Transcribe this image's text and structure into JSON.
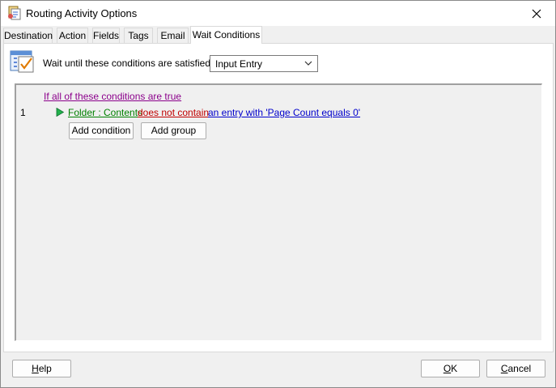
{
  "window": {
    "title": "Routing Activity Options"
  },
  "tabs": [
    {
      "label": "Destination"
    },
    {
      "label": "Action"
    },
    {
      "label": "Fields"
    },
    {
      "label": "Tags"
    },
    {
      "label": "Email"
    },
    {
      "label": "Wait Conditions",
      "active": true
    }
  ],
  "wait": {
    "label": "Wait until these conditions are satisfied for:",
    "selected": "Input Entry"
  },
  "conditions": {
    "group_link": "If all of these conditions are true",
    "rows": [
      {
        "number": "1",
        "field": "Folder : Contents",
        "operator": "does not contain",
        "value": "an entry with 'Page Count equals 0'"
      }
    ],
    "add_condition_label": "Add condition",
    "add_group_label": "Add group"
  },
  "footer": {
    "help": {
      "accel": "H",
      "rest": "elp"
    },
    "ok": {
      "accel": "O",
      "rest": "K"
    },
    "cancel": {
      "accel": "C",
      "rest": "ancel"
    }
  },
  "icons": {
    "title": "routing-activity-icon",
    "conditions": "checklist-icon",
    "run": "green-play-icon",
    "close": "close-icon",
    "dropdown": "chevron-down-icon"
  },
  "colors": {
    "group_link": "#8b008b",
    "field_link": "#008000",
    "operator_link": "#c00000",
    "value_link": "#0000cc"
  }
}
